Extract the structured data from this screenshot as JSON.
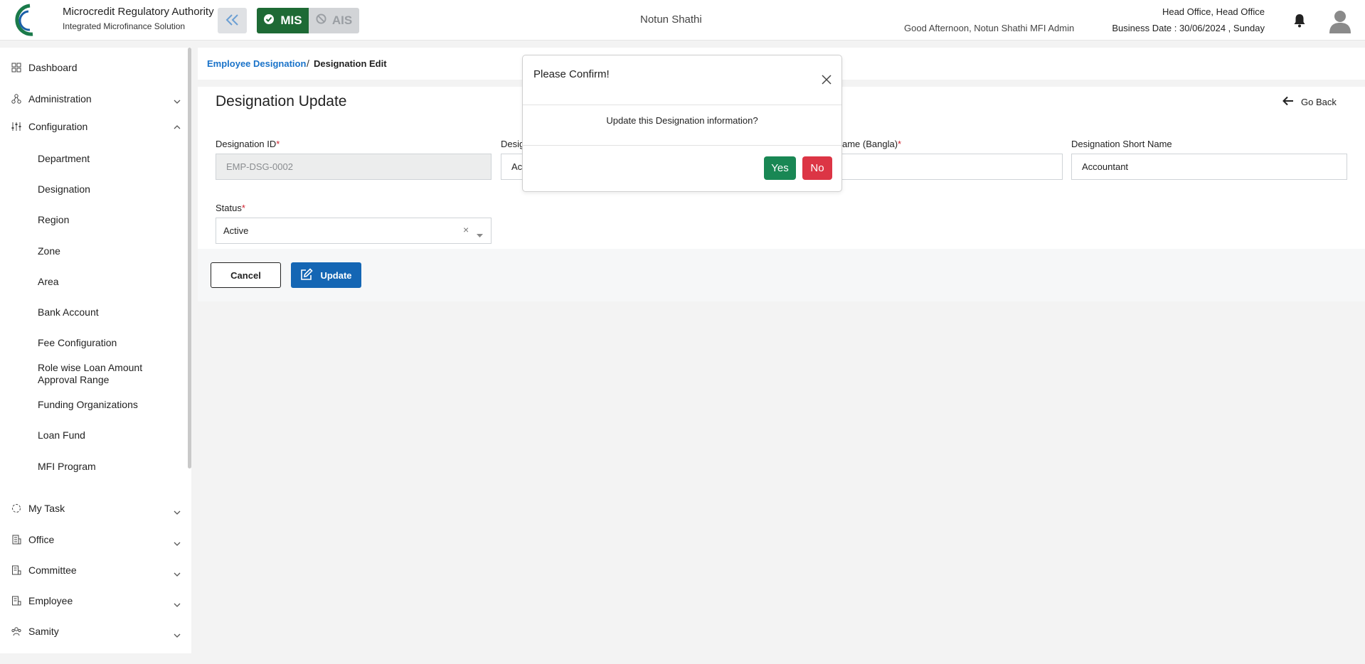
{
  "header": {
    "brand_title": "Microcredit Regulatory Authority",
    "brand_subtitle": "Integrated Microfinance Solution",
    "logo_text": "Microcredit Regulatory Authority",
    "mode_mis": "MIS",
    "mode_ais": "AIS",
    "org_name": "Notun Shathi",
    "greeting": "Good Afternoon, Notun Shathi MFI Admin",
    "office": "Head Office, Head Office",
    "business_date": "Business Date : 30/06/2024 , Sunday"
  },
  "sidebar": {
    "dashboard": "Dashboard",
    "administration": "Administration",
    "configuration": "Configuration",
    "config_items": [
      "Department",
      "Designation",
      "Region",
      "Zone",
      "Area",
      "Bank Account",
      "Fee Configuration",
      "Role wise Loan Amount Approval Range",
      "Funding Organizations",
      "Loan Fund",
      "MFI Program"
    ],
    "my_task": "My Task",
    "office": "Office",
    "committee": "Committee",
    "employee": "Employee",
    "samity": "Samity"
  },
  "breadcrumb": {
    "parent": "Employee Designation",
    "separator": "/",
    "current": "Designation Edit"
  },
  "form": {
    "title": "Designation Update",
    "go_back": "Go Back",
    "designation_id_label": "Designation ID",
    "designation_id_value": "EMP-DSG-0002",
    "designation_name_label_partial": "Desig",
    "designation_name_value_partial": "Ac",
    "designation_bangla_label_partial": "ame (Bangla)",
    "designation_short_label": "Designation Short Name",
    "designation_short_value": "Accountant",
    "status_label": "Status",
    "status_value": "Active",
    "required_mark": "*",
    "clear_symbol": "×",
    "cancel": "Cancel",
    "update": "Update"
  },
  "modal": {
    "title": "Please Confirm!",
    "message": "Update this Designation information?",
    "yes": "Yes",
    "no": "No"
  },
  "colors": {
    "mis_green": "#1e6a35",
    "primary_blue": "#1466b4",
    "link_blue": "#1a73c9",
    "yes_green": "#198754",
    "no_red": "#dc3545"
  }
}
